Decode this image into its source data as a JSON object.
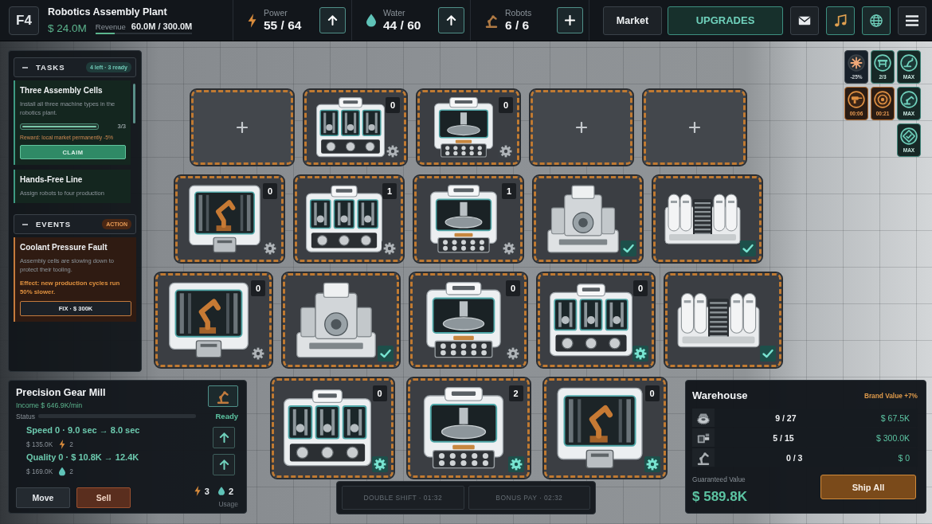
{
  "header": {
    "floor": "F4",
    "plant_name": "Robotics Assembly Plant",
    "cash": "$ 24.0M",
    "revenue": {
      "label": "Revenue",
      "value": "60.0M / 300.0M",
      "level": 0.2
    }
  },
  "resources": [
    {
      "label": "Power",
      "value": "55 / 64",
      "kind": "upgrade"
    },
    {
      "label": "Water",
      "value": "44 / 60",
      "kind": "upgrade"
    },
    {
      "label": "Robots",
      "value": "6 / 6",
      "kind": "add"
    }
  ],
  "nav_buttons": [
    {
      "label": "Market",
      "highlighted": false
    },
    {
      "label": "UPGRADES",
      "highlighted": true
    }
  ],
  "icon_buttons": [
    {
      "highlighted": false
    },
    {
      "highlighted": true
    },
    {
      "highlighted": true
    },
    {
      "highlighted": false
    }
  ],
  "tasks": {
    "title": "TASKS",
    "badge": "4 left · 3 ready",
    "expanded": true,
    "items": [
      {
        "title": "Three Assembly Cells",
        "description": "Install all three machine types in the robotics plant.",
        "progress": {
          "level": 1,
          "text": "3/3"
        },
        "reward": "Reward: local market permanently -5%",
        "button": "CLAIM"
      },
      {
        "title": "Hands-Free Line",
        "description": "Assign robots to four production"
      }
    ]
  },
  "events": {
    "title": "EVENTS",
    "badge": "ACTION",
    "expanded": true,
    "items": [
      {
        "title": "Coolant Pressure Fault",
        "description": "Assembly cells are slowing down to protect their tooling.",
        "effect": "Effect: new production cycles run 50% slower.",
        "button": "FIX · $ 300K"
      }
    ]
  },
  "side_perks": [
    [
      {
        "label": "-25%",
        "kind": "buff"
      },
      {
        "label": "2/3",
        "kind": "upgrade"
      },
      {
        "label": "MAX",
        "kind": "upgrade"
      }
    ],
    [
      {
        "label": "00:06",
        "kind": "timer"
      },
      {
        "label": "00:21",
        "kind": "timer"
      },
      {
        "label": "MAX",
        "kind": "upgrade"
      }
    ],
    [
      {
        "label": "MAX",
        "kind": "upgrade"
      }
    ]
  ],
  "floor": {
    "rows": [
      [
        {
          "kind": "empty"
        },
        {
          "kind": "triple-cell",
          "count": "0",
          "done": false,
          "active": false
        },
        {
          "kind": "mill",
          "count": "0",
          "done": false,
          "active": false
        },
        {
          "kind": "empty"
        },
        {
          "kind": "empty"
        }
      ],
      [
        {
          "kind": "robot",
          "count": "0",
          "done": false,
          "active": false
        },
        {
          "kind": "triple-cell",
          "count": "1",
          "done": false,
          "active": false
        },
        {
          "kind": "mill",
          "count": "1",
          "done": false,
          "active": false
        },
        {
          "kind": "lathe",
          "done": true,
          "active": true
        },
        {
          "kind": "press",
          "done": true,
          "active": true
        }
      ],
      [
        {
          "kind": "robot",
          "count": "0",
          "done": false,
          "active": false
        },
        {
          "kind": "lathe",
          "done": true,
          "active": true
        },
        {
          "kind": "mill",
          "count": "0",
          "done": false,
          "active": false
        },
        {
          "kind": "triple-cell",
          "count": "0",
          "done": false,
          "active": true
        },
        {
          "kind": "press",
          "done": true,
          "active": true
        }
      ],
      [
        {
          "kind": "triple-cell",
          "count": "0",
          "done": false,
          "active": true
        },
        {
          "kind": "mill",
          "count": "2",
          "done": false,
          "active": true
        },
        {
          "kind": "robot",
          "count": "0",
          "done": false,
          "active": true
        }
      ]
    ]
  },
  "machine_panel": {
    "name": "Precision Gear Mill",
    "income": "Income $ 646.9K/min",
    "status": {
      "label": "Status",
      "text": "Ready"
    },
    "upgrades": [
      {
        "text": "Speed 0 · 9.0 sec → 8.0 sec",
        "cost": "$ 135.0K",
        "kind": "power",
        "amount": "2"
      },
      {
        "text": "Quality 0 · $ 10.8K → 12.4K",
        "cost": "$ 169.0K",
        "kind": "water",
        "amount": "2"
      }
    ],
    "buttons": [
      {
        "label": "Move",
        "kind": "neutral"
      },
      {
        "label": "Sell",
        "kind": "danger"
      }
    ],
    "usage": [
      {
        "kind": "power",
        "amount": "3"
      },
      {
        "kind": "water",
        "amount": "2"
      }
    ],
    "usage_label": "Usage"
  },
  "boosts": [
    {
      "label": "DOUBLE SHIFT · 01:32",
      "disabled": true
    },
    {
      "label": "BONUS PAY · 02:32",
      "disabled": true
    }
  ],
  "warehouse": {
    "title": "Warehouse",
    "brand": "Brand Value +7%",
    "rows": [
      {
        "amount": "9 / 27",
        "value": "$ 67.5K"
      },
      {
        "amount": "5 / 15",
        "value": "$ 300.0K"
      },
      {
        "amount": "0 / 3",
        "value": "$ 0"
      }
    ],
    "total_label": "Guaranteed Value",
    "total": "$ 589.8K",
    "button": "Ship All"
  }
}
